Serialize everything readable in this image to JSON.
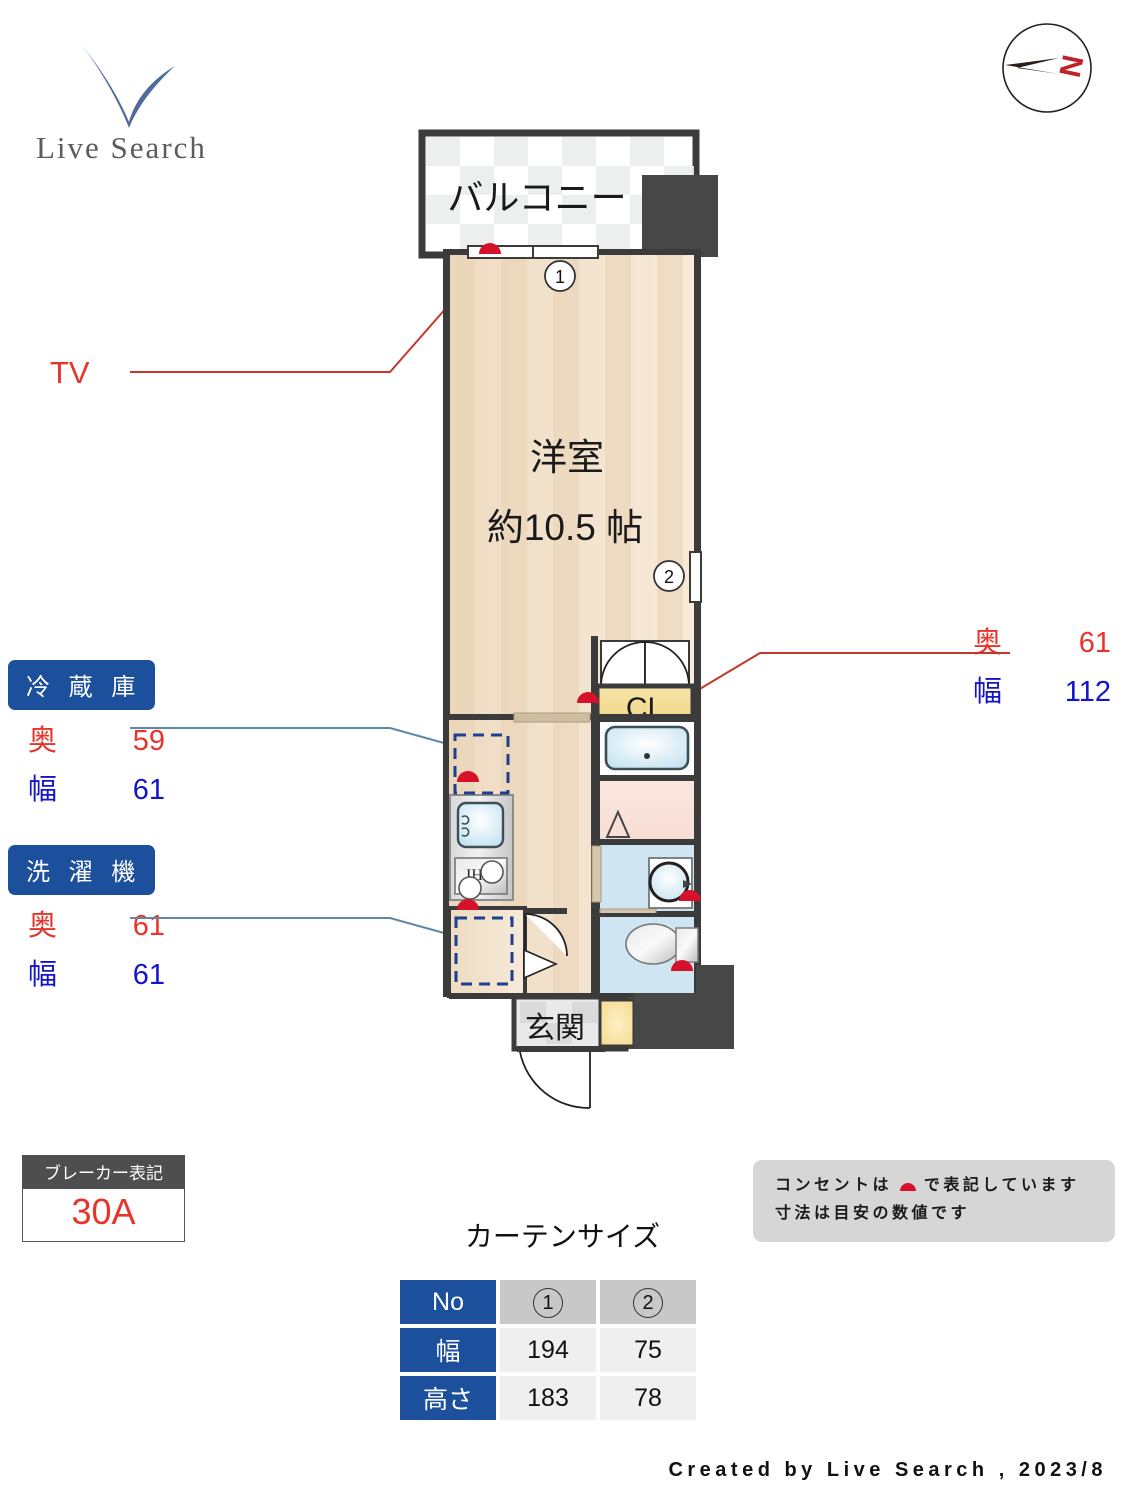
{
  "brand": {
    "logo_text": "Live Search",
    "logo_mark": "check-v-mark"
  },
  "compass": {
    "label": "N",
    "icon": "compass-north-icon"
  },
  "callouts": {
    "tv": {
      "label": "TV"
    }
  },
  "appliance_specs": [
    {
      "id": "fridge",
      "title": "冷 蔵 庫",
      "depth_label": "奥",
      "depth_value": "59",
      "width_label": "幅",
      "width_value": "61"
    },
    {
      "id": "washer",
      "title": "洗 濯 機",
      "depth_label": "奥",
      "depth_value": "61",
      "width_label": "幅",
      "width_value": "61"
    }
  ],
  "closet_spec": {
    "depth_label": "奥",
    "depth_value": "61",
    "width_label": "幅",
    "width_value": "112"
  },
  "floorplan": {
    "balcony_label": "バルコニー",
    "room_name": "洋室",
    "room_size": "約10.5 帖",
    "closet_label": "CL",
    "entrance_label": "玄関",
    "stove_label": "IH",
    "window_markers": [
      "1",
      "2"
    ]
  },
  "breaker": {
    "title": "ブレーカー表記",
    "value": "30A"
  },
  "note": {
    "line1_pre": "コンセントは",
    "line1_post": "で表記しています",
    "line2": "寸法は目安の数値です"
  },
  "curtain": {
    "title": "カーテンサイズ",
    "header": [
      "No",
      "1",
      "2"
    ],
    "rows": [
      {
        "label": "幅",
        "values": [
          "194",
          "75"
        ]
      },
      {
        "label": "高さ",
        "values": [
          "183",
          "78"
        ]
      }
    ]
  },
  "footer": {
    "text": "Created by Live Search , 2023/8"
  },
  "colors": {
    "accent_blue": "#1c4f9c",
    "depth_red": "#e8352b",
    "width_blue": "#1414c8",
    "wall": "#3b3b3b",
    "floor": "#f2decb",
    "closet": "#f3d98a"
  }
}
